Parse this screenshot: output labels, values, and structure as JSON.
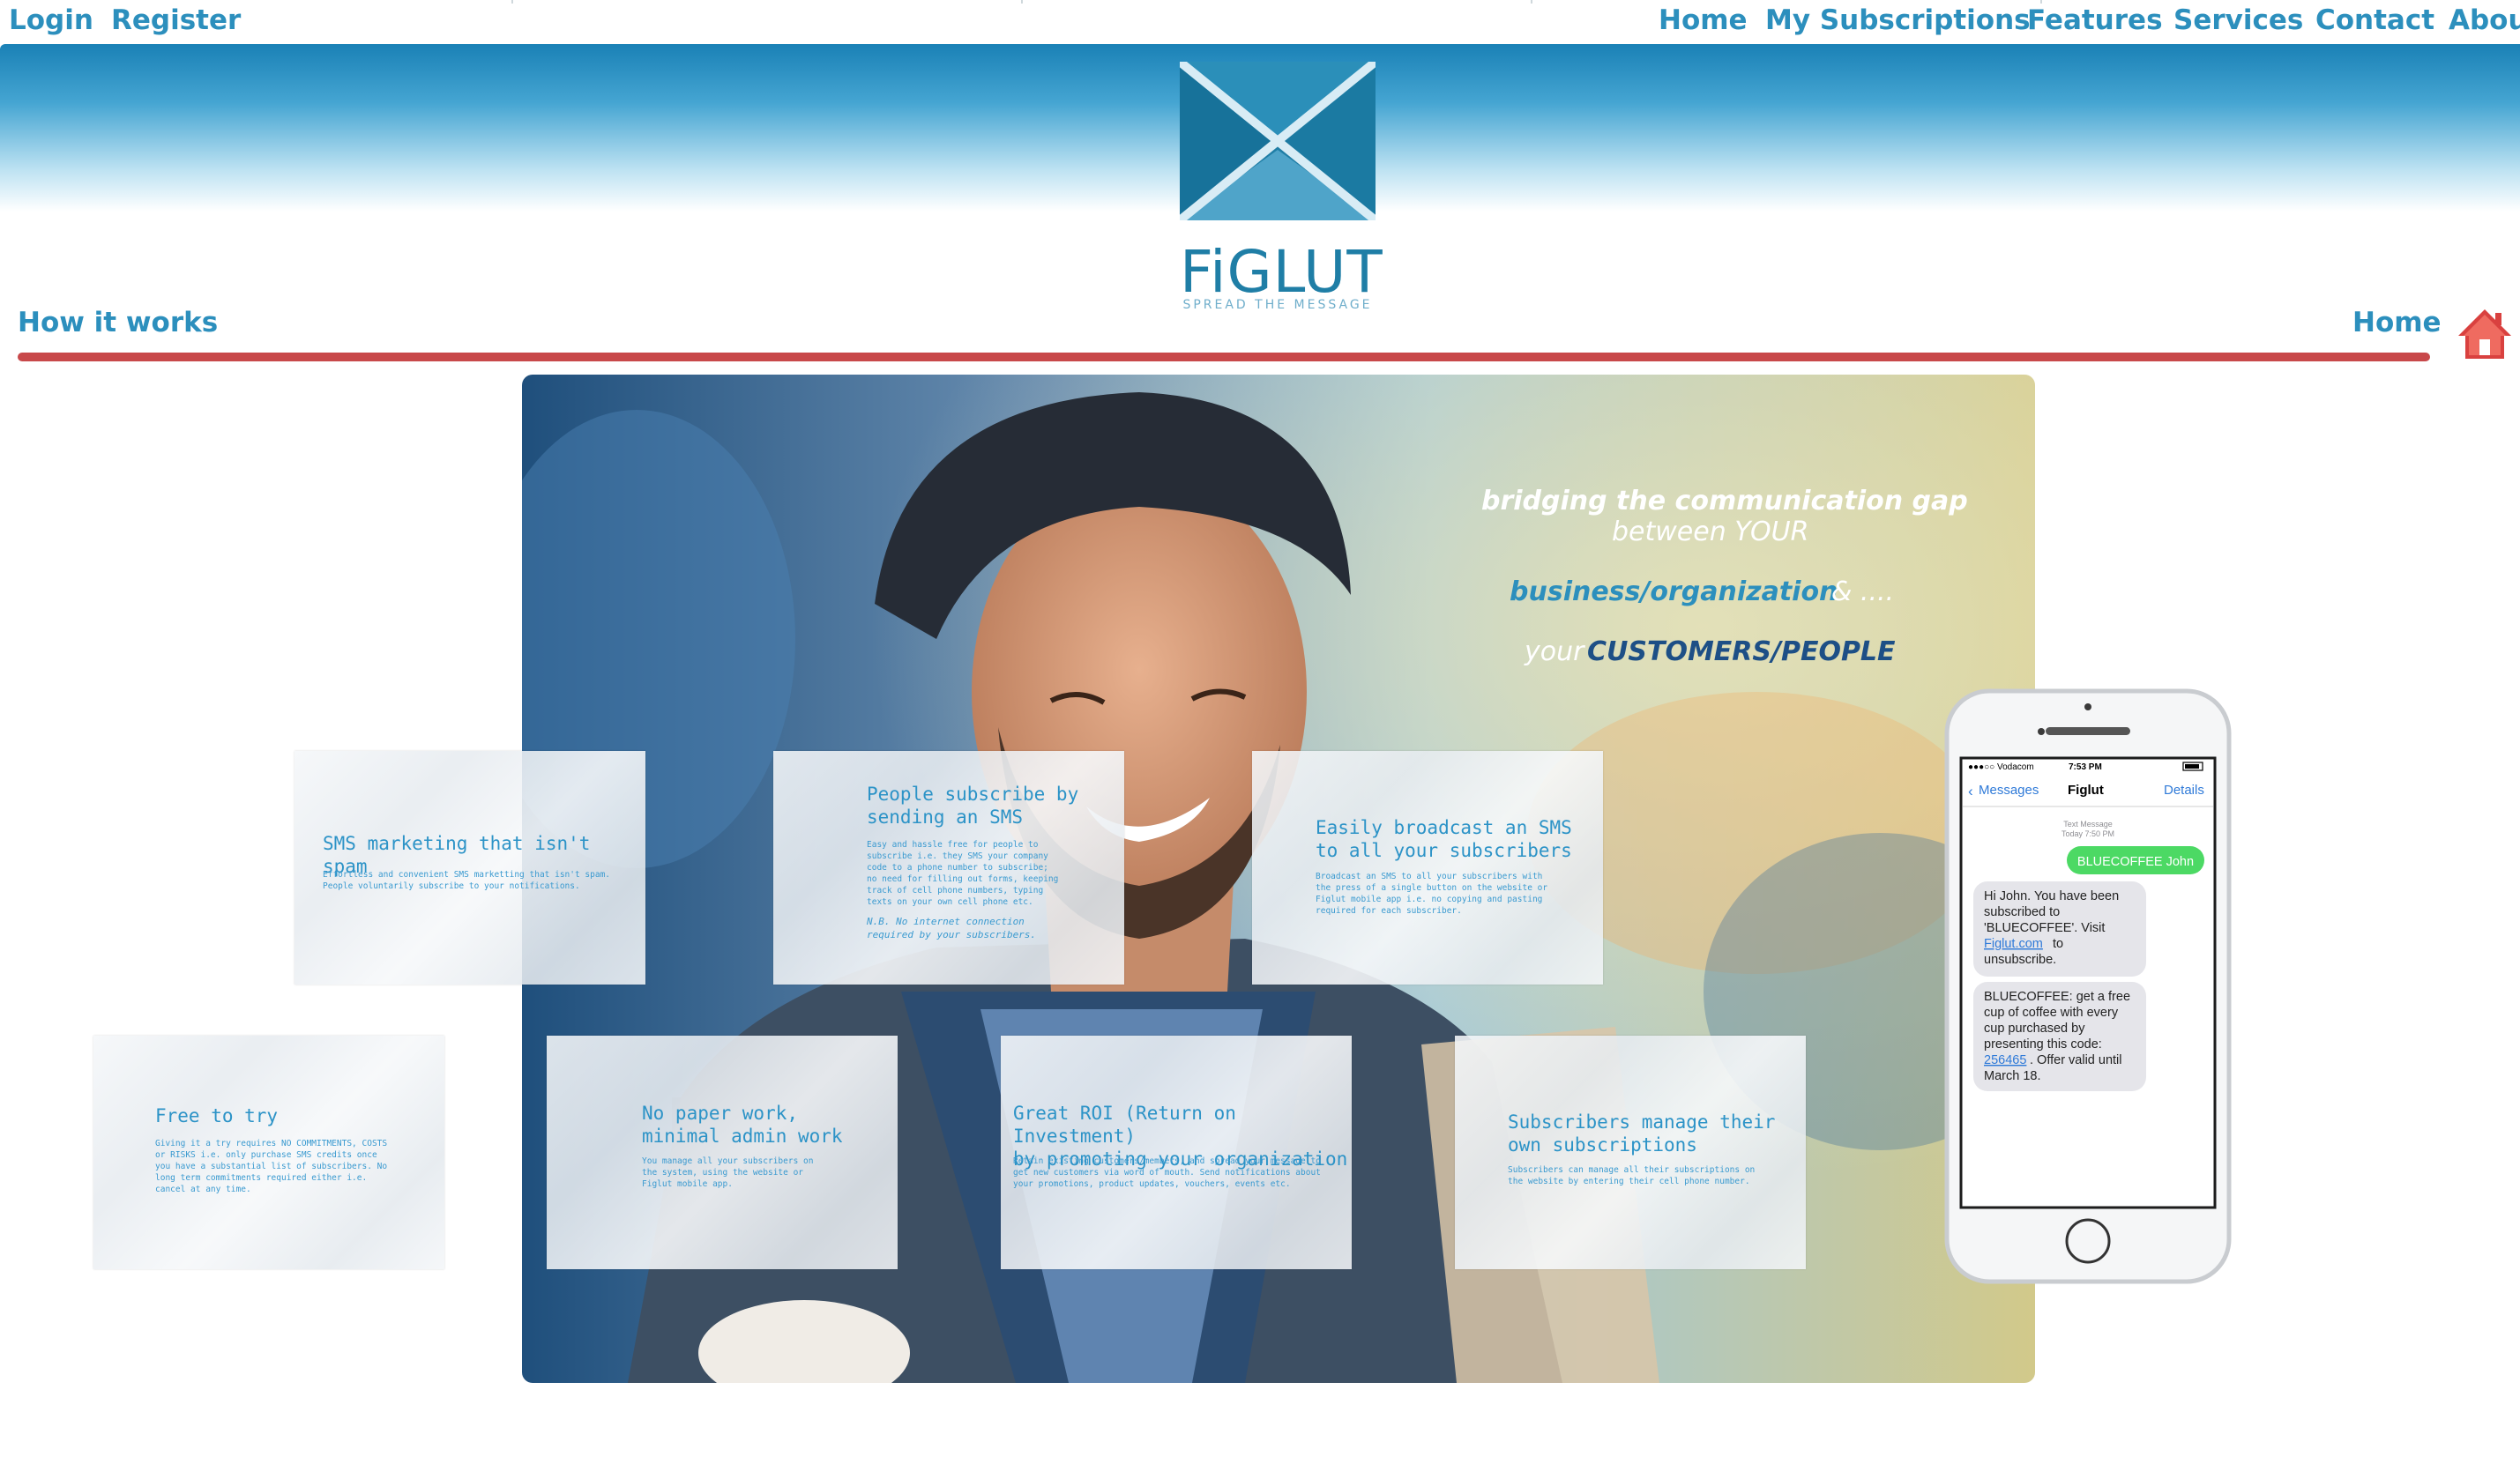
{
  "top_nav": {
    "left": [
      "Login",
      "Register"
    ],
    "right": [
      "Home",
      "My Subscriptions",
      "Features",
      "Services",
      "Contact",
      "Abou"
    ]
  },
  "logo": {
    "name": "FiGLUT",
    "tagline": "SPREAD THE MESSAGE"
  },
  "sub_nav": {
    "left": "How it works",
    "right": "Home",
    "home_icon": "home-icon"
  },
  "hero": {
    "lines": [
      "bridging the communication gap",
      "between YOUR",
      "business/organization",
      "& ....",
      "your",
      "CUSTOMERS/PEOPLE"
    ]
  },
  "cards": [
    {
      "title": "SMS marketing that isn't spam",
      "body": "Effortless and convenient SMS marketting that isn't spam.\nPeople voluntarily subscribe to your notifications."
    },
    {
      "title": "People subscribe by\nsending an SMS",
      "body": "Easy and hassle free for people to\nsubscribe i.e. they SMS your company\ncode to a phone number to subscribe;\nno need for filling out forms, keeping\ntrack of cell phone numbers, typing\ntexts on your own cell phone etc.",
      "note": "N.B. No internet connection\nrequired by your subscribers."
    },
    {
      "title": "Easily broadcast an SMS\nto all your subscribers",
      "body": "Broadcast an SMS to all your subscribers with\nthe press of a single button on the website or\nFiglut mobile app i.e. no copying and pasting\nrequired for each subscriber."
    },
    {
      "title": "Free to try",
      "body": "Giving it a try requires NO COMMITMENTS, COSTS\nor RISKS i.e. only purchase SMS credits once\nyou have a substantial list of subscribers. No\nlong term commitments required either i.e.\ncancel at any time."
    },
    {
      "title": "No paper work,\nminimal admin work",
      "body": "You manage all your subscribers on\nthe system, using the website or\nFiglut mobile app."
    },
    {
      "title": "Great ROI (Return on Investment)\nby promoting your organization",
      "body": "Retain existing customers/members, and spread your message to\nget new customers via word of mouth. Send notifications about\nyour promotions, product updates, vouchers, events etc."
    },
    {
      "title": "Subscribers manage their\nown subscriptions",
      "body": "Subscribers can manage all their subscriptions on\nthe website by entering their cell phone number."
    }
  ],
  "phone": {
    "carrier": "●●●○○ Vodacom",
    "time": "7:53 PM",
    "back": "Messages",
    "contact": "Figlut",
    "details": "Details",
    "meta1": "Text Message",
    "meta2": "Today 7:50 PM",
    "sent": "BLUECOFFEE John",
    "recv1": [
      "Hi John. You have been",
      "subscribed to",
      "'BLUECOFFEE'. Visit",
      "Figlut.com",
      "to",
      "unsubscribe."
    ],
    "recv2": [
      "BLUECOFFEE: get a free",
      "cup of coffee with every",
      "cup purchased by",
      "presenting this code:",
      "256465",
      ". Offer valid until",
      "March 18."
    ]
  },
  "colors": {
    "link": "#2c8fbd",
    "red_line": "#c8484a",
    "imessage_green": "#4cd964",
    "header_blue": "#1a81b6"
  }
}
